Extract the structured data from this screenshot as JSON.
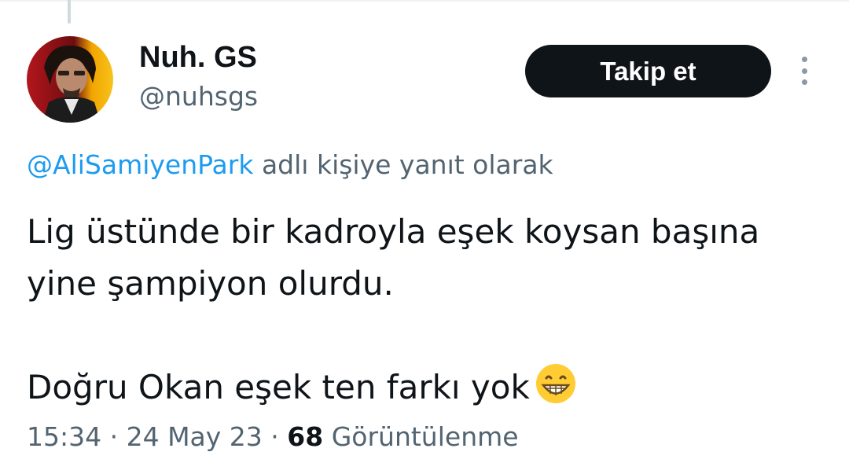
{
  "tweet": {
    "author": {
      "display_name": "Nuh. GS",
      "handle": "@nuhsgs"
    },
    "follow_button_label": "Takip et",
    "more_icon": "more-vertical-icon",
    "reply": {
      "mention": "@AliSamiyenPark",
      "suffix": " adlı kişiye yanıt olarak"
    },
    "text_lines": [
      "Lig üstünde bir kadroyla eşek koysan başına",
      "yine şampiyon olurdu.",
      "Doğru Okan eşek ten farkı yok"
    ],
    "emoji": "grinning-face-emoji",
    "meta": {
      "time": "15:34",
      "date": "24 May 23",
      "platform": "",
      "views_count": "68",
      "views_label": "Görüntülenme"
    }
  },
  "colors": {
    "text_primary": "#0f1419",
    "text_secondary": "#536471",
    "link": "#1d9bf0",
    "button_bg": "#0f1419",
    "button_text": "#ffffff"
  }
}
